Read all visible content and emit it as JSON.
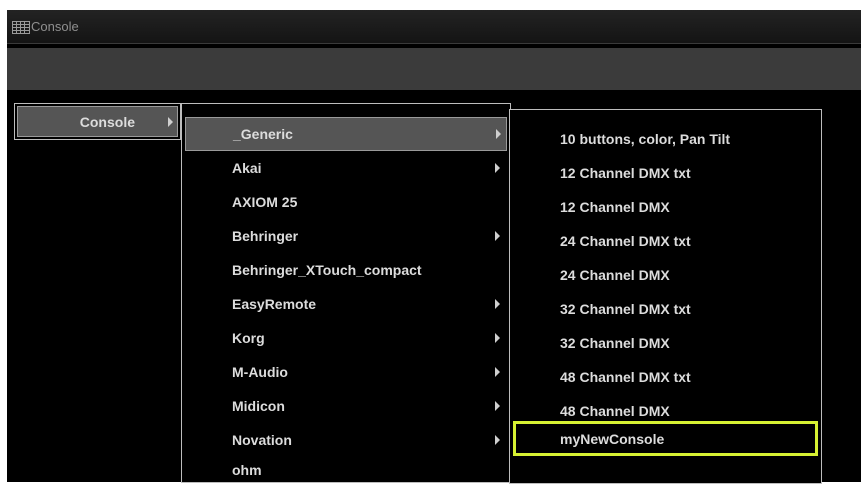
{
  "window": {
    "title": "Console",
    "title_icon": "grid-table-icon"
  },
  "colors": {
    "menu_text": "#dcdcdc",
    "highlight_bg": "#555555",
    "selection_outline": "#d6f032",
    "toolbar_bg": "#3b3b3b"
  },
  "menu_root": {
    "items": [
      {
        "label": "Console",
        "has_submenu": true,
        "highlighted": true
      }
    ]
  },
  "menu_manufacturers": {
    "items": [
      {
        "label": "_Generic",
        "has_submenu": true,
        "highlighted": true
      },
      {
        "label": "Akai",
        "has_submenu": true
      },
      {
        "label": "AXIOM 25",
        "has_submenu": false
      },
      {
        "label": "Behringer",
        "has_submenu": true
      },
      {
        "label": "Behringer_XTouch_compact",
        "has_submenu": false
      },
      {
        "label": "EasyRemote",
        "has_submenu": true
      },
      {
        "label": "Korg",
        "has_submenu": true
      },
      {
        "label": "M-Audio",
        "has_submenu": true
      },
      {
        "label": "Midicon",
        "has_submenu": true
      },
      {
        "label": "Novation",
        "has_submenu": true
      },
      {
        "label": "ohm",
        "has_submenu": false
      }
    ]
  },
  "menu_generic": {
    "items": [
      {
        "label": "10 buttons, color, Pan Tilt"
      },
      {
        "label": "12 Channel DMX txt"
      },
      {
        "label": "12 Channel DMX"
      },
      {
        "label": "24 Channel DMX txt"
      },
      {
        "label": "24 Channel DMX"
      },
      {
        "label": "32 Channel DMX txt"
      },
      {
        "label": "32 Channel DMX"
      },
      {
        "label": "48 Channel DMX txt"
      },
      {
        "label": "48 Channel DMX"
      },
      {
        "label": "myNewConsole",
        "selected": true
      }
    ]
  }
}
